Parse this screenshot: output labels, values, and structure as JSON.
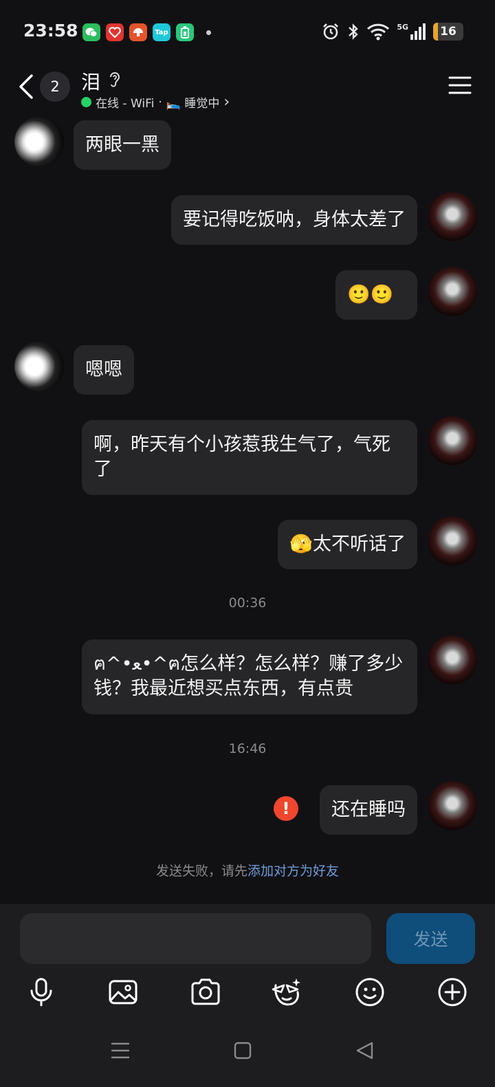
{
  "status_bar": {
    "time": "23:58",
    "network": "5G",
    "battery": "16",
    "battery_level": 0.16,
    "notification_apps": [
      {
        "icon": "wechat-icon",
        "color": "#2bbd5e",
        "label": ""
      },
      {
        "icon": "heart-app-icon",
        "color": "#e0342f",
        "label": ""
      },
      {
        "icon": "mushroom-app-icon",
        "color": "#e4532c",
        "label": ""
      },
      {
        "icon": "taptap-icon",
        "color": "#20c7d9",
        "label": "Tap"
      },
      {
        "icon": "battery-app-icon",
        "color": "#29c77b",
        "label": ""
      }
    ]
  },
  "header": {
    "unread_count": "2",
    "contact_name": "泪",
    "status_online": "在线 - WiFi",
    "separator": "·",
    "status_activity": "🛌 睡觉中",
    "chevron": "›"
  },
  "messages": [
    {
      "side": "left",
      "text": "两眼一黑"
    },
    {
      "side": "right",
      "text": "要记得吃饭呐，身体太差了"
    },
    {
      "side": "right",
      "text": "🙂🙂"
    },
    {
      "side": "left",
      "text": "嗯嗯"
    },
    {
      "side": "right",
      "text": "啊，昨天有个小孩惹我生气了，气死了"
    },
    {
      "side": "right",
      "text": "🫣太不听话了"
    },
    {
      "type": "time",
      "text": "00:36"
    },
    {
      "side": "right",
      "text": "ฅ^•ﻌ•^ฅ怎么样？怎么样？赚了多少钱？我最近想买点东西，有点贵"
    },
    {
      "type": "time",
      "text": "16:46"
    },
    {
      "side": "right",
      "text": "还在睡吗",
      "failed": true
    }
  ],
  "failure_notice": {
    "prefix": "发送失败，请先",
    "link": "添加对方为好友"
  },
  "input": {
    "placeholder": "",
    "send_label": "发送"
  },
  "colors": {
    "background": "#111114",
    "bubble": "#262628",
    "send_button": "#0f4d7a",
    "link": "#6f9bd8",
    "error": "#f0462e",
    "online": "#25d366"
  }
}
